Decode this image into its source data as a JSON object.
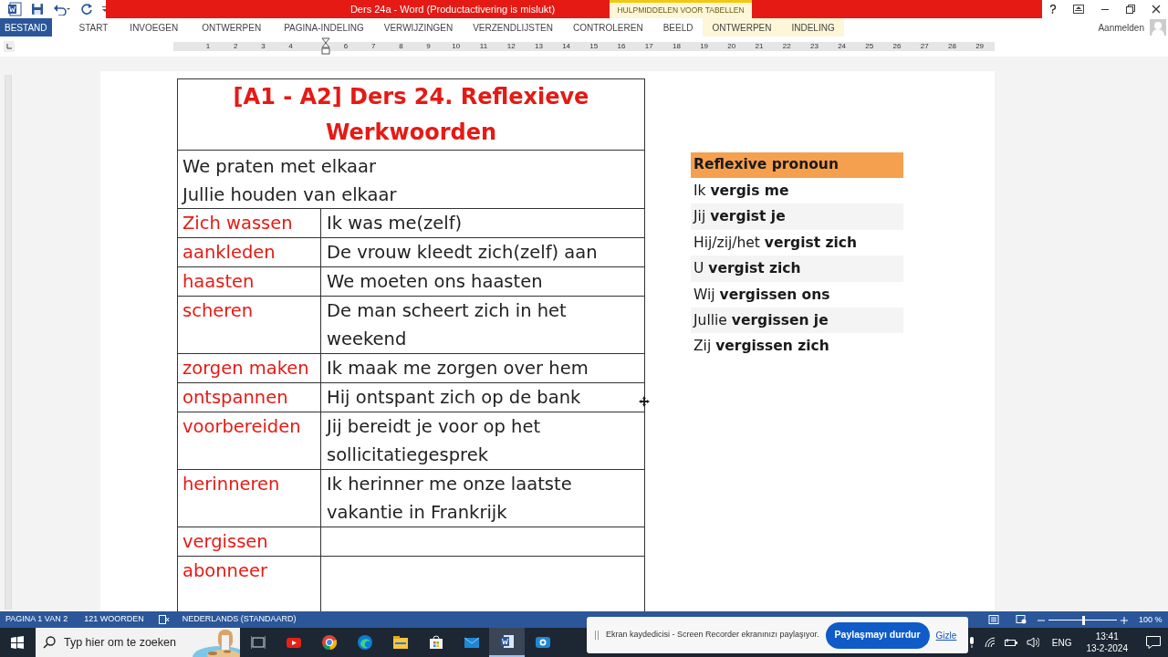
{
  "window": {
    "title": "Ders 24a -  Word (Productactivering is mislukt)",
    "context_header": "HULPMIDDELEN VOOR TABELLEN",
    "account": "Aanmelden"
  },
  "ribbon_tabs": [
    {
      "label": "BESTAND",
      "kind": "file"
    },
    {
      "label": "START",
      "kind": "normal"
    },
    {
      "label": "INVOEGEN",
      "kind": "normal"
    },
    {
      "label": "ONTWERPEN",
      "kind": "normal"
    },
    {
      "label": "PAGINA-INDELING",
      "kind": "normal"
    },
    {
      "label": "VERWIJZINGEN",
      "kind": "normal"
    },
    {
      "label": "VERZENDLIJSTEN",
      "kind": "normal"
    },
    {
      "label": "CONTROLEREN",
      "kind": "normal"
    },
    {
      "label": "BEELD",
      "kind": "normal"
    },
    {
      "label": "ONTWERPEN",
      "kind": "context"
    },
    {
      "label": "INDELING",
      "kind": "context"
    }
  ],
  "ruler": {
    "left_numbers": [
      "1",
      "2",
      "3",
      "4"
    ],
    "right_numbers": [
      "6",
      "7",
      "8",
      "9",
      "10",
      "11",
      "12",
      "13",
      "14",
      "15",
      "16",
      "17",
      "18",
      "19",
      "20",
      "21",
      "22",
      "23",
      "24",
      "25",
      "26",
      "27",
      "28",
      "29"
    ]
  },
  "document": {
    "title": "[A1 - A2] Ders 24. Reflexieve Werkwoorden",
    "intro": [
      "We praten met elkaar",
      "Jullie houden van elkaar"
    ],
    "rows": [
      {
        "verb": "Zich wassen",
        "example": [
          "Ik was me(zelf)"
        ]
      },
      {
        "verb": "aankleden",
        "example": [
          "De vrouw kleedt zich(zelf) aan"
        ]
      },
      {
        "verb": "haasten",
        "example": [
          "We moeten ons haasten"
        ]
      },
      {
        "verb": "scheren",
        "example": [
          "De man scheert zich in het",
          "weekend"
        ]
      },
      {
        "verb": "zorgen maken",
        "example": [
          "Ik maak me zorgen over hem"
        ]
      },
      {
        "verb": "ontspannen",
        "example": [
          "Hij ontspant zich op de bank"
        ]
      },
      {
        "verb": "voorbereiden",
        "example": [
          "Jij bereidt je voor op het",
          "sollicitatiegesprek"
        ]
      },
      {
        "verb": "herinneren",
        "example": [
          "Ik herinner me onze laatste",
          "vakantie in Frankrijk"
        ]
      },
      {
        "verb": "vergissen",
        "example": []
      },
      {
        "verb": "abonneer",
        "example": []
      }
    ],
    "pronoun_table": {
      "header": "Reflexive pronoun",
      "rows": [
        "Ik **vergis me**",
        "Jij **vergist je**",
        "Hij/zij/het **vergist zich**",
        "U **vergist zich**",
        "Wij **vergissen ons**",
        "Jullie **vergissen je**",
        "Zij **vergissen zich**"
      ]
    }
  },
  "status_bar": {
    "page": "PAGINA 1 VAN 2",
    "words": "121 WOORDEN",
    "language": "NEDERLANDS (STANDAARD)",
    "zoom": {
      "level": 0.5,
      "reading": "100 %"
    }
  },
  "share_notice": {
    "text": "Ekran kaydedicisi - Screen Recorder ekranınızı paylaşıyor.",
    "button": "Paylaşmayı durdur",
    "link": "Gizle"
  },
  "taskbar": {
    "search_placeholder": "Typ hier om te zoeken",
    "language": "ENG",
    "time": "13:41",
    "date": "13-2-2024"
  }
}
